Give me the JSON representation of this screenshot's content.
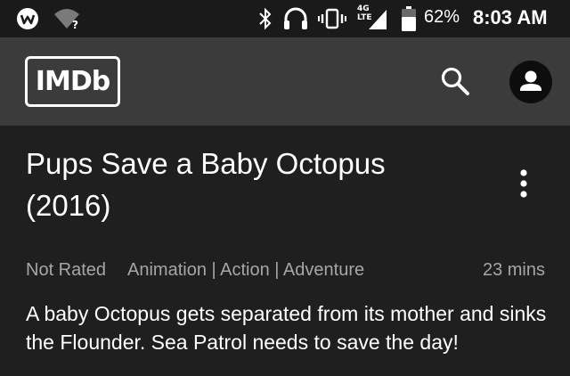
{
  "status_bar": {
    "battery_percent": "62%",
    "time": "8:03 AM",
    "network_label_top": "4G",
    "network_label_bottom": "LTE",
    "icons": [
      "app-w-icon",
      "wifi-question-icon",
      "bluetooth-icon",
      "headset-icon",
      "vibrate-icon",
      "signal-icon",
      "battery-icon"
    ]
  },
  "header": {
    "logo_text": "IMDb",
    "icons": [
      "search-icon",
      "account-icon"
    ]
  },
  "title": {
    "name": "Pups Save a Baby Octopus",
    "year": "(2016)"
  },
  "meta": {
    "rating": "Not Rated",
    "genres": "Animation | Action | Adventure",
    "runtime": "23 mins"
  },
  "plot": "A baby Octopus gets separated from its mother and sinks the Flounder. Sea Patrol needs to save the day!",
  "colors": {
    "background": "#1f1f1f",
    "status_bar": "#1a1a1a",
    "app_bar": "#3b3b3b",
    "secondary_text": "#a6a6a6"
  }
}
